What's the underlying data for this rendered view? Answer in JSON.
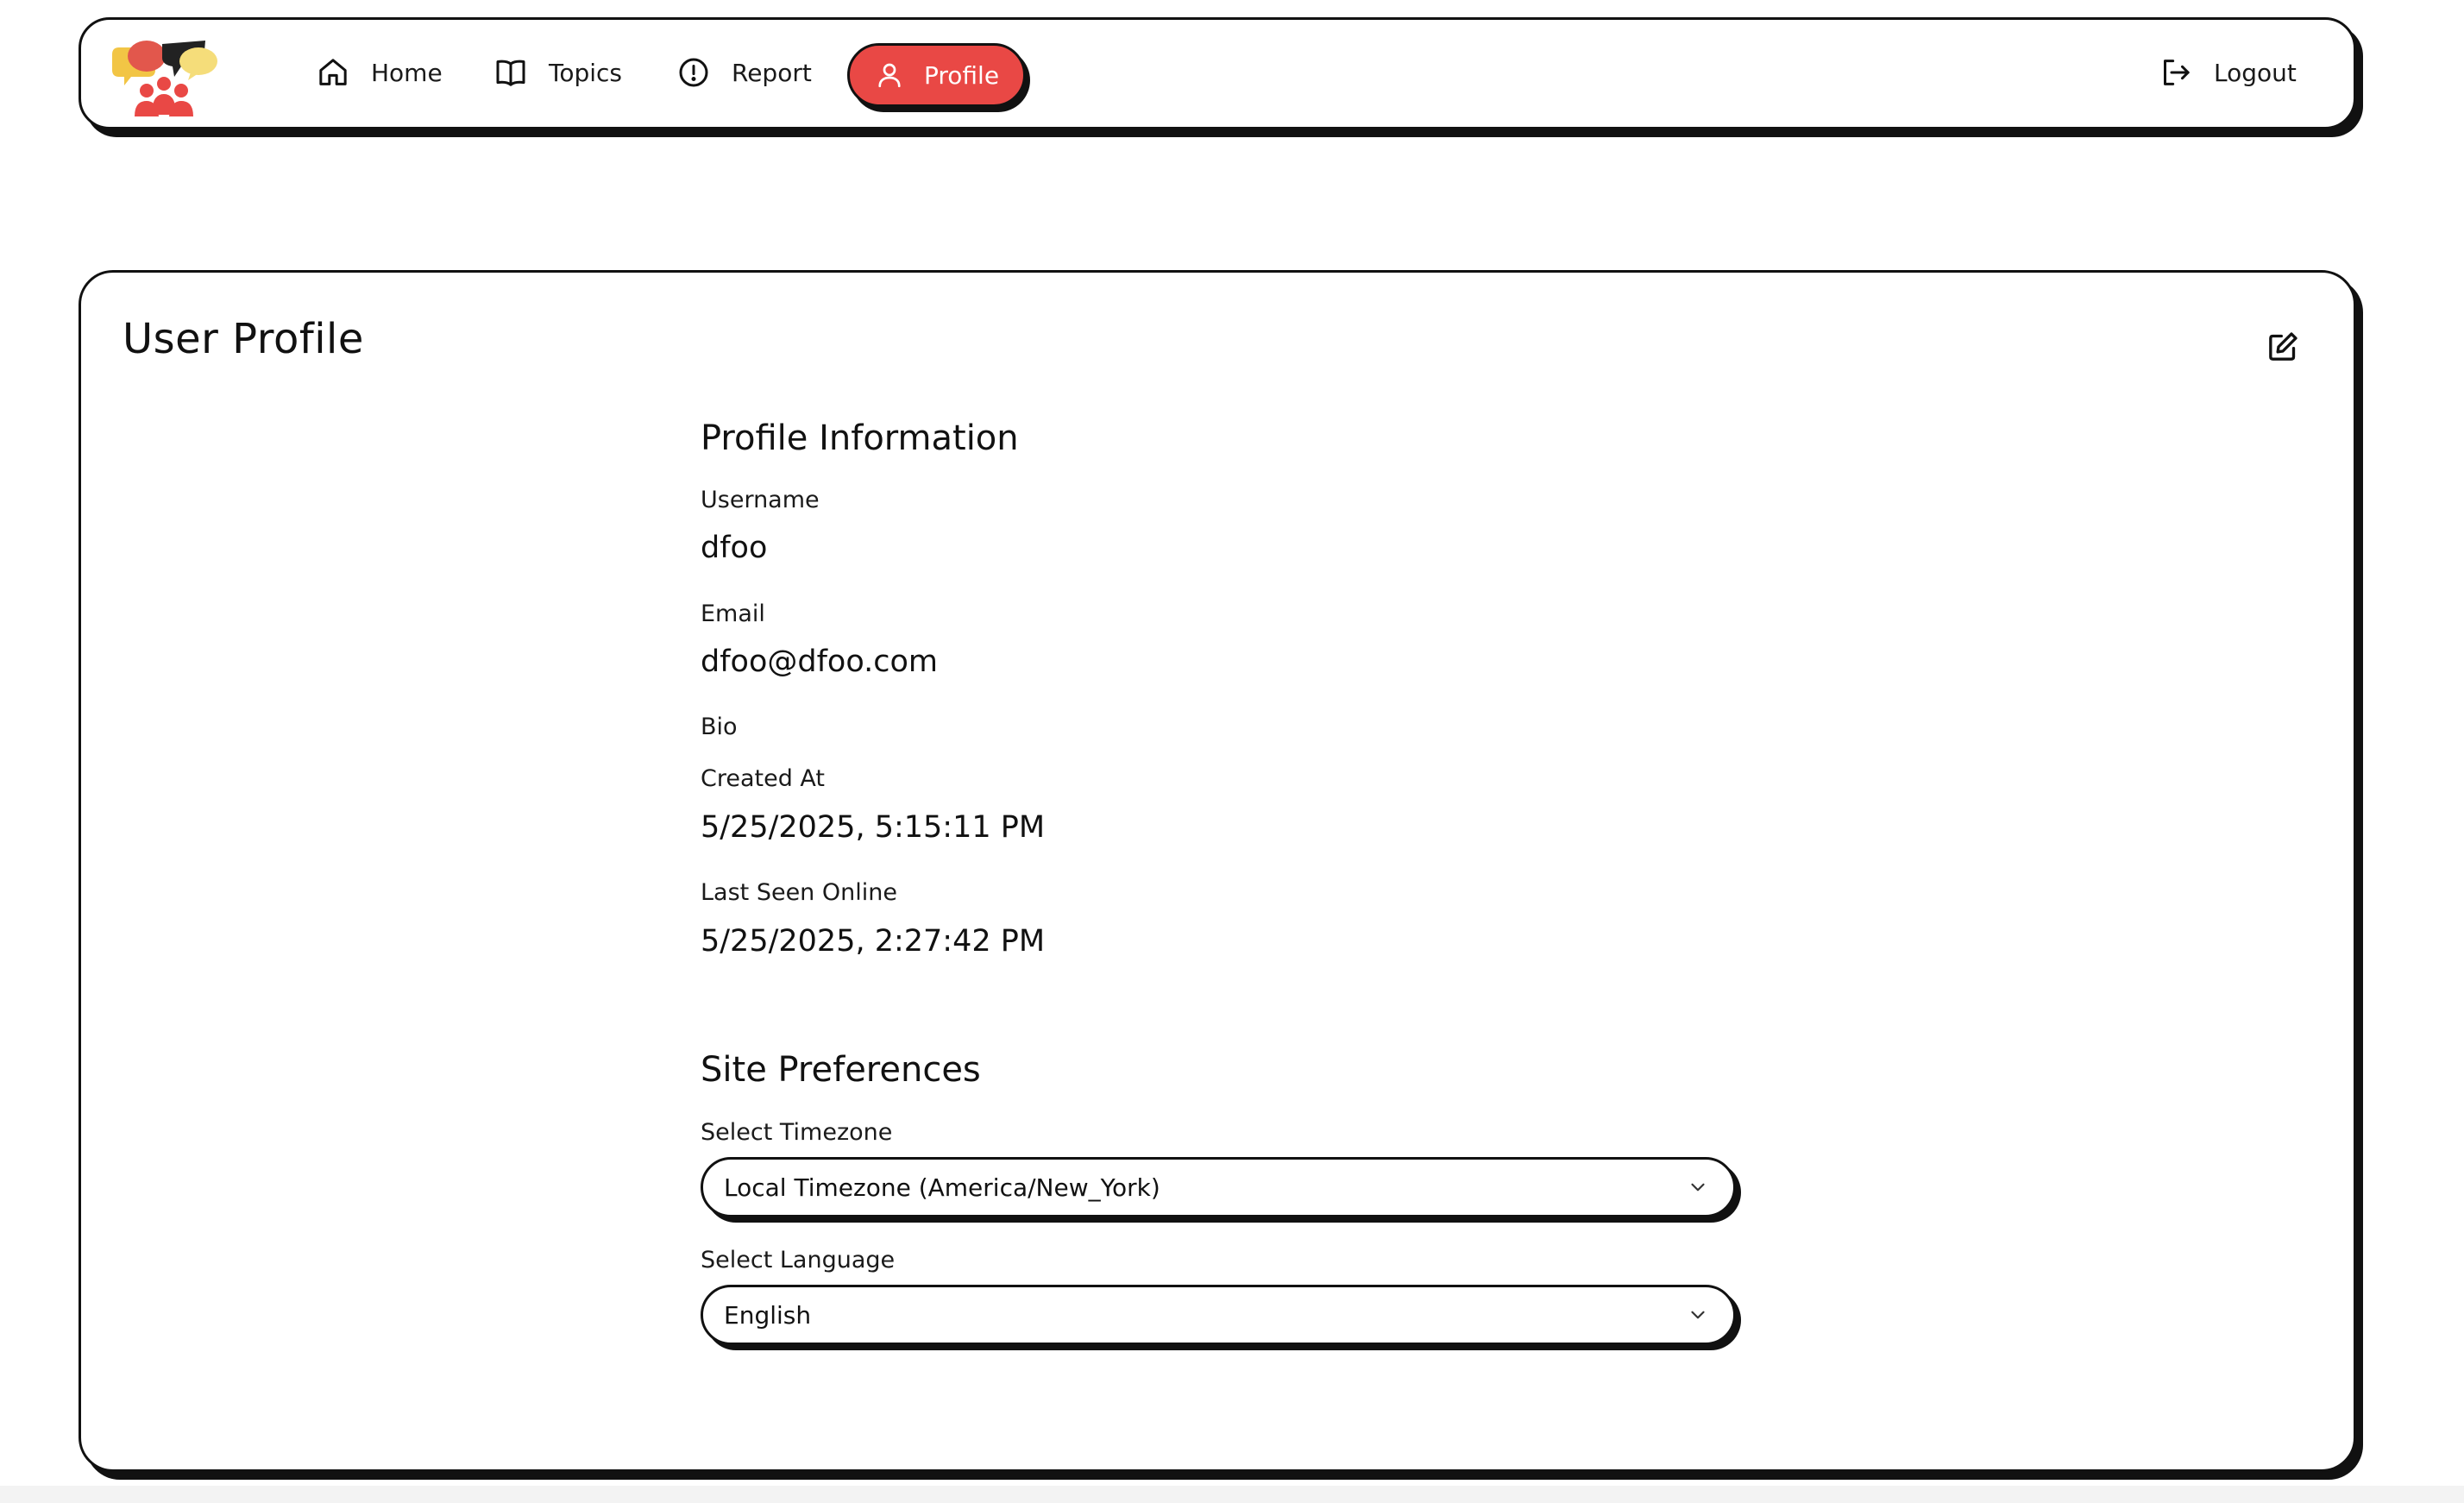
{
  "nav": {
    "items": [
      {
        "label": "Home",
        "icon": "home-icon"
      },
      {
        "label": "Topics",
        "icon": "book-icon"
      },
      {
        "label": "Report",
        "icon": "alert-circle-icon"
      },
      {
        "label": "Profile",
        "icon": "user-icon",
        "active": true
      }
    ],
    "logout_label": "Logout",
    "accent_color": "#e94845"
  },
  "profile": {
    "title": "User Profile",
    "info_heading": "Profile Information",
    "username_label": "Username",
    "username": "dfoo",
    "email_label": "Email",
    "email": "dfoo@dfoo.com",
    "bio_label": "Bio",
    "bio": "",
    "created_label": "Created At",
    "created_at": "5/25/2025, 5:15:11 PM",
    "last_seen_label": "Last Seen Online",
    "last_seen": "5/25/2025, 2:27:42 PM"
  },
  "preferences": {
    "heading": "Site Preferences",
    "timezone_label": "Select Timezone",
    "timezone_value": "Local Timezone (America/New_York)",
    "language_label": "Select Language",
    "language_value": "English"
  }
}
